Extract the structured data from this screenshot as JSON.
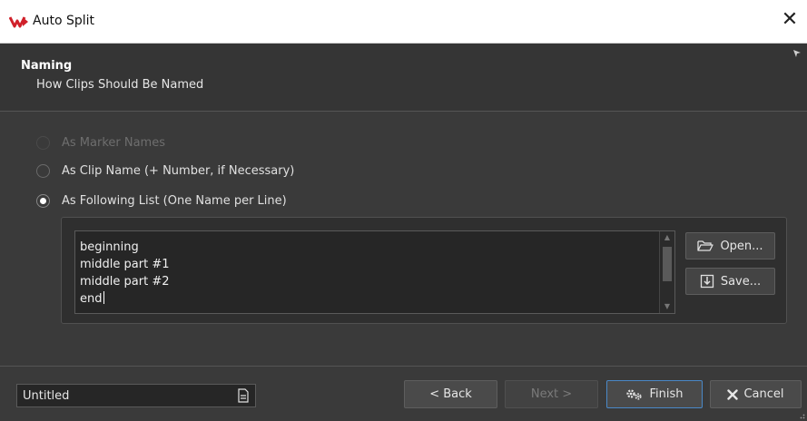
{
  "window": {
    "title": "Auto Split",
    "close_icon": "close-icon",
    "logo_icon": "wavelab-logo"
  },
  "header": {
    "title": "Naming",
    "subtitle": "How Clips Should Be Named"
  },
  "naming_options": [
    {
      "label": "As Marker Names",
      "state": "disabled"
    },
    {
      "label": "As Clip Name (+ Number, if Necessary)",
      "state": "unchecked"
    },
    {
      "label": "As Following List (One Name per Line)",
      "state": "checked"
    }
  ],
  "name_list": {
    "lines": [
      "beginning",
      "middle part #1",
      "middle part #2",
      "end"
    ]
  },
  "side_buttons": {
    "open_label": "Open...",
    "save_label": "Save..."
  },
  "footer": {
    "preset_value": "Untitled",
    "back_label": "< Back",
    "next_label": "Next >",
    "finish_label": "Finish",
    "cancel_label": "Cancel"
  },
  "colors": {
    "accent": "#4a88c7",
    "background": "#3a3a3a",
    "logo_red": "#d0202a"
  }
}
